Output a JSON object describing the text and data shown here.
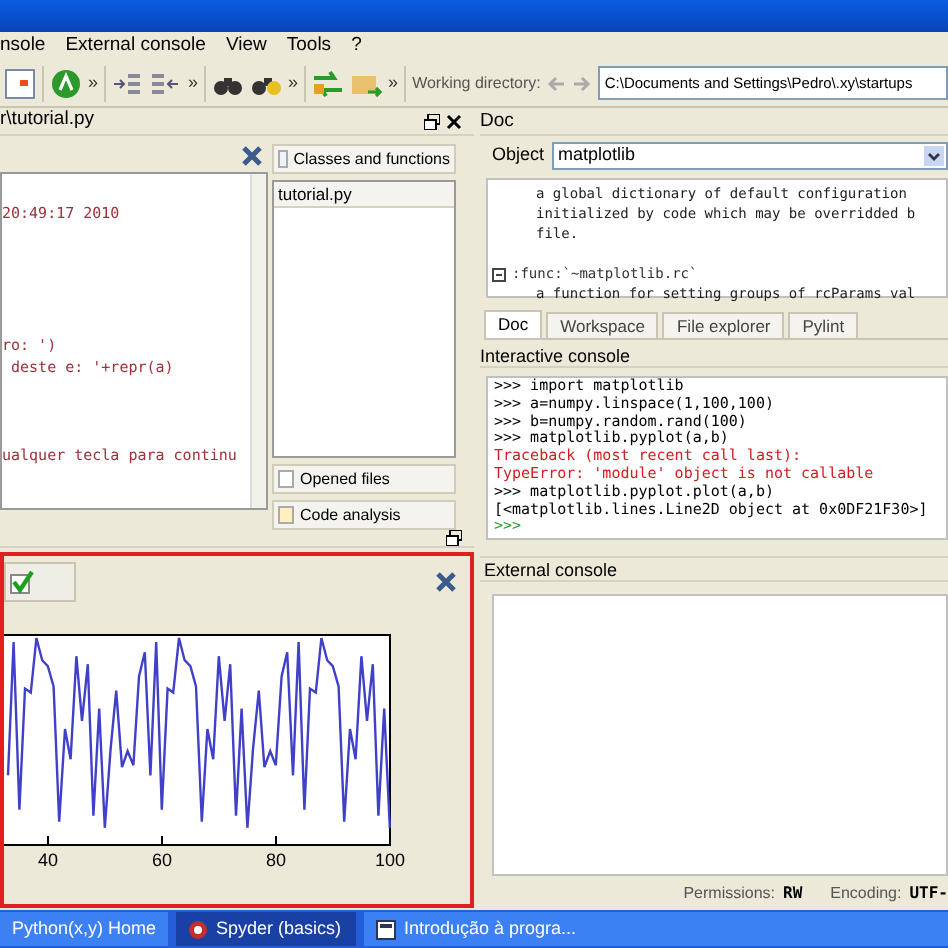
{
  "menu": [
    "nsole",
    "External console",
    "View",
    "Tools",
    "?"
  ],
  "toolbar": {
    "overflow": [
      "»",
      "»",
      "»",
      "»"
    ],
    "working_dir_label": "Working directory:",
    "working_dir": "C:\\Documents and Settings\\Pedro\\.xy\\startups"
  },
  "editor": {
    "title": "r\\tutorial.py",
    "lines": [
      {
        "kind": "blank"
      },
      {
        "text": "20:49:17 2010",
        "kind": "string"
      },
      {
        "kind": "blank"
      },
      {
        "kind": "blank"
      },
      {
        "kind": "blank"
      },
      {
        "kind": "blank"
      },
      {
        "kind": "blank"
      },
      {
        "text": "ro: ')",
        "kind": "string"
      },
      {
        "text": " deste e: '+repr(a)",
        "kind": "string"
      },
      {
        "kind": "blank"
      },
      {
        "kind": "blank"
      },
      {
        "kind": "blank"
      },
      {
        "text": "ualquer tecla para continu",
        "kind": "string"
      }
    ]
  },
  "class_browser": {
    "button": "Classes and functions",
    "file": "tutorial.py",
    "opened_files": "Opened files",
    "code_analysis": "Code analysis"
  },
  "doc": {
    "title": "Doc",
    "object_label": "Object",
    "object": "matplotlib",
    "lines": [
      {
        "text": "a global dictionary of default configuration",
        "kind": "body"
      },
      {
        "text": "initialized by code which may be overridded b",
        "kind": "body"
      },
      {
        "text": "file.",
        "kind": "body"
      },
      {
        "kind": "blank"
      },
      {
        "text": ":func:`~matplotlib.rc`",
        "kind": "heading"
      },
      {
        "text": "a function for setting groups of rcParams val",
        "kind": "body"
      }
    ]
  },
  "tabs": [
    {
      "label": "Doc",
      "selected": true
    },
    {
      "label": "Workspace",
      "selected": false
    },
    {
      "label": "File explorer",
      "selected": false
    },
    {
      "label": "Pylint",
      "selected": false
    }
  ],
  "interactive_console": {
    "title": "Interactive console",
    "lines": [
      {
        "text": ">>> import matplotlib",
        "kind": "input"
      },
      {
        "text": ">>> a=numpy.linspace(1,100,100)",
        "kind": "input"
      },
      {
        "text": ">>> b=numpy.random.rand(100)",
        "kind": "input"
      },
      {
        "text": ">>> matplotlib.pyplot(a,b)",
        "kind": "input"
      },
      {
        "text": "Traceback (most recent call last):",
        "kind": "error"
      },
      {
        "text": "TypeError: 'module' object is not callable",
        "kind": "error"
      },
      {
        "text": ">>> matplotlib.pyplot.plot(a,b)",
        "kind": "input"
      },
      {
        "text": "[<matplotlib.lines.Line2D object at 0x0DF21F30>]",
        "kind": "output"
      },
      {
        "text": ">>>",
        "kind": "prompt"
      }
    ]
  },
  "figure": {
    "x_tick_labels": [
      "40",
      "60",
      "80",
      "100"
    ]
  },
  "external_console": {
    "title": "External console"
  },
  "status_bar": {
    "permissions_label": "Permissions:",
    "permissions": "RW",
    "encoding_label": "Encoding:",
    "encoding": "UTF-"
  },
  "taskbar": [
    {
      "label": "Python(x,y) Home",
      "selected": false
    },
    {
      "label": "Spyder (basics)",
      "selected": true
    },
    {
      "label": "Introdução à progra...",
      "selected": false
    }
  ]
}
